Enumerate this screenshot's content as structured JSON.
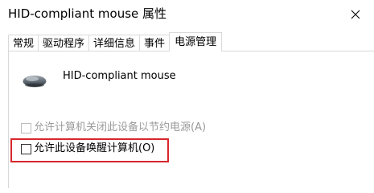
{
  "window": {
    "title": "HID-compliant mouse 属性",
    "close_glyph": "✕"
  },
  "tabs": [
    {
      "label": "常规",
      "active": false
    },
    {
      "label": "驱动程序",
      "active": false
    },
    {
      "label": "详细信息",
      "active": false
    },
    {
      "label": "事件",
      "active": false
    },
    {
      "label": "电源管理",
      "active": true
    }
  ],
  "device": {
    "icon": "mouse-icon",
    "name": "HID-compliant mouse"
  },
  "options": {
    "allow_power_off": {
      "label": "允许计算机关闭此设备以节约电源(A)",
      "checked": false,
      "enabled": false
    },
    "allow_wake": {
      "label": "允许此设备唤醒计算机(O)",
      "checked": false,
      "enabled": true
    }
  },
  "colors": {
    "highlight": "#d9262d",
    "disabled_text": "#9a9a9a",
    "border": "#d9d9d9"
  }
}
